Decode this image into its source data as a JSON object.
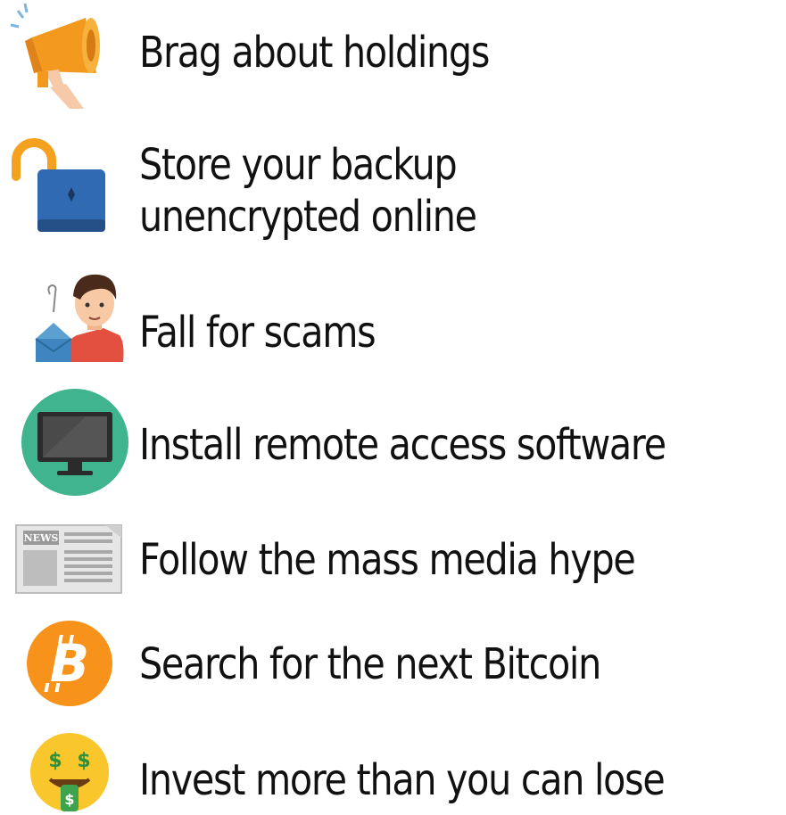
{
  "items": [
    {
      "icon": "megaphone-icon",
      "label": "Brag about holdings"
    },
    {
      "icon": "open-padlock-icon",
      "label_line1": "Store your backup",
      "label_line2": "unencrypted online"
    },
    {
      "icon": "phishing-person-icon",
      "label": "Fall for scams"
    },
    {
      "icon": "monitor-icon",
      "label": "Install remote access software"
    },
    {
      "icon": "newspaper-icon",
      "label": "Follow the mass media hype",
      "icon_text": "NEWS"
    },
    {
      "icon": "bitcoin-icon",
      "label": "Search for the next Bitcoin"
    },
    {
      "icon": "money-face-emoji-icon",
      "label": "Invest more than you can lose"
    }
  ],
  "colors": {
    "orange": "#f39a1e",
    "blue": "#2f6ab3",
    "teal": "#3fb48f",
    "text": "#111111"
  }
}
